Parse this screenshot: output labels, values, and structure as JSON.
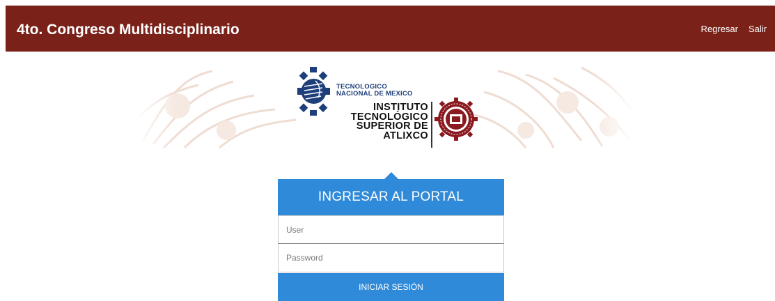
{
  "header": {
    "title": "4to. Congreso Multidisciplinario",
    "nav": {
      "back_label": "Regresar",
      "exit_label": "Salir"
    }
  },
  "banner": {
    "tecnm_line1": "TECNOLOGICO",
    "tecnm_line2": "NACIONAL DE MEXICO",
    "itsa_line1": "INSTITUTO",
    "itsa_line2": "TECNOLÓGICO",
    "itsa_line3": "SUPERIOR DE",
    "itsa_line4": "ATLIXCO"
  },
  "login": {
    "title": "INGRESAR AL PORTAL",
    "user_placeholder": "User",
    "password_placeholder": "Password",
    "submit_label": "INICIAR SESIÓN"
  },
  "colors": {
    "header_bg": "#7a2219",
    "accent": "#2f8ad9",
    "banner_pattern": "#f3e3da"
  }
}
